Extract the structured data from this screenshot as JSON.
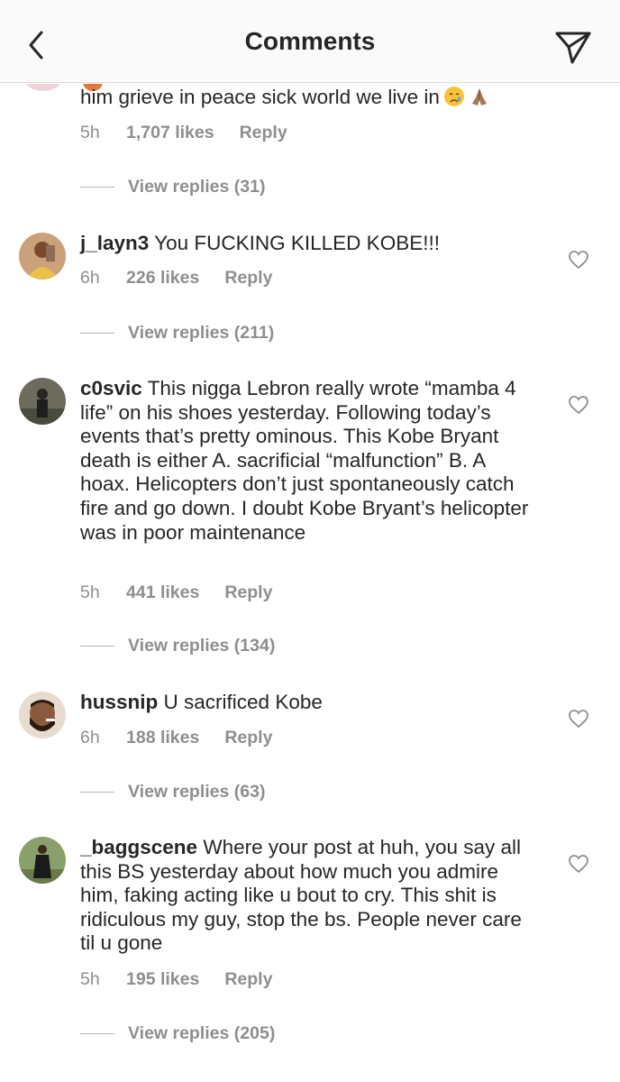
{
  "header": {
    "title": "Comments",
    "back_icon": "chevron-left-icon",
    "share_icon": "paper-plane-icon"
  },
  "comments": [
    {
      "username": "",
      "text": "him grieve in peace sick world we live in",
      "emojis": [
        "crying-face-emoji",
        "folded-hands-emoji"
      ],
      "time": "5h",
      "likes": "1,707 likes",
      "reply": "Reply",
      "view_replies": "View replies (31)"
    },
    {
      "username": "j_layn3",
      "text": "You FUCKING KILLED KOBE!!!",
      "time": "6h",
      "likes": "226 likes",
      "reply": "Reply",
      "view_replies": "View replies (211)"
    },
    {
      "username": "c0svic",
      "text": "This nigga Lebron really wrote “mamba 4 life” on his shoes yesterday. Following today’s events that’s pretty ominous. This Kobe Bryant death is either A. sacrificial “malfunction” B. A hoax. Helicopters don’t just spontaneously catch fire and go down. I doubt Kobe Bryant’s helicopter was in poor maintenance",
      "time": "5h",
      "likes": "441 likes",
      "reply": "Reply",
      "view_replies": "View replies (134)"
    },
    {
      "username": "hussnip",
      "text": "U sacrificed Kobe",
      "time": "6h",
      "likes": "188 likes",
      "reply": "Reply",
      "view_replies": "View replies (63)"
    },
    {
      "username": "_baggscene",
      "text": "Where your post at huh, you say all this BS yesterday about how much you admire him, faking acting like u bout to cry. This shit is ridiculous my guy, stop the bs. People never care til u gone",
      "time": "5h",
      "likes": "195 likes",
      "reply": "Reply",
      "view_replies": "View replies (205)"
    }
  ],
  "colors": {
    "text": "#262626",
    "secondary": "#8e8e8e",
    "header_bg": "#fafafa",
    "divider": "#dbdbdb"
  }
}
